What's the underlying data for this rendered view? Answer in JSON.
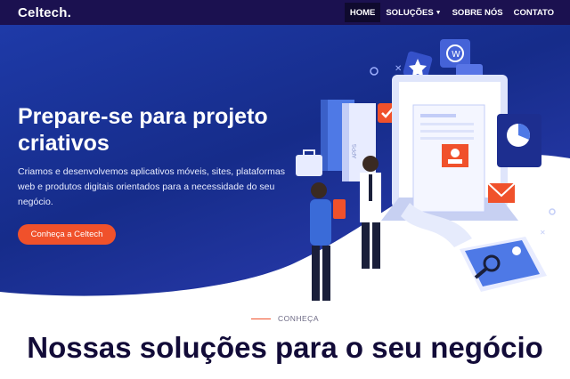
{
  "header": {
    "logo": "Celtech.",
    "nav": [
      {
        "label": "HOME",
        "active": true
      },
      {
        "label": "SOLUÇÕES",
        "dropdown": true
      },
      {
        "label": "SOBRE NÓS"
      },
      {
        "label": "CONTATO"
      }
    ]
  },
  "hero": {
    "title": "Prepare-se para projeto criativos",
    "subtitle": "Criamos e desenvolvemos aplicativos móveis, sites, plataformas web e produtos digitais orientados para a necessidade do seu negócio.",
    "cta_label": "Conheça a Celtech",
    "illustration_text": "APPS"
  },
  "section": {
    "tag": "CONHEÇA",
    "title": "Nossas soluções para o seu negócio"
  },
  "colors": {
    "navbar": "#1b1150",
    "hero_blue": "#1e3aa8",
    "accent": "#f0512b",
    "title_dark": "#120b38"
  }
}
